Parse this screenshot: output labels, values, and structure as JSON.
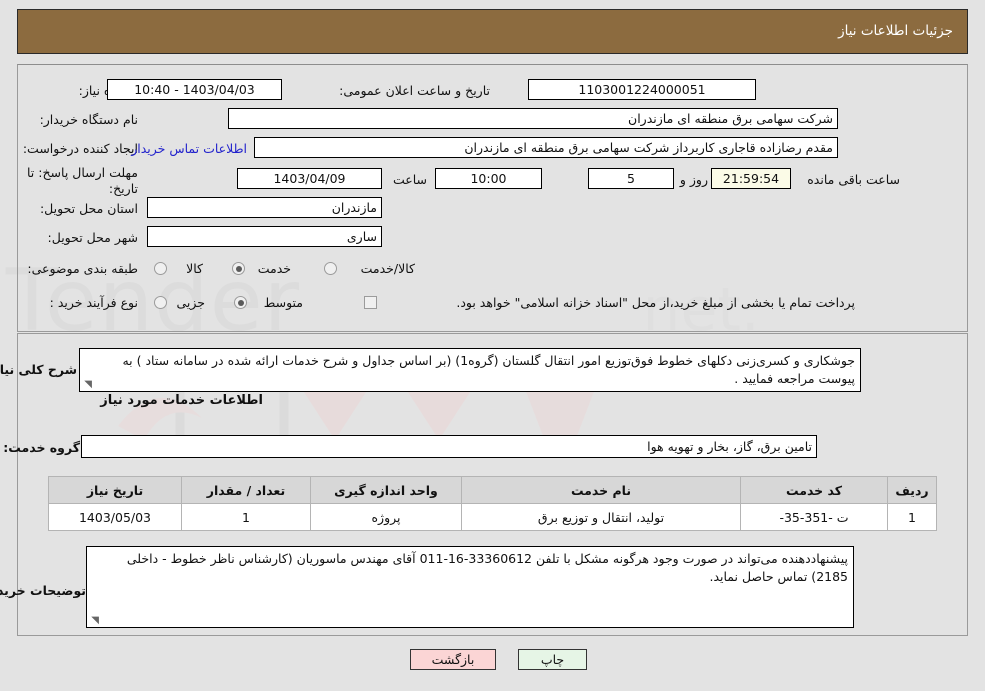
{
  "header": {
    "title": "جزئیات اطلاعات نیاز"
  },
  "form": {
    "need_number_label": "شماره نیاز:",
    "need_number_value": "1103001224000051",
    "announce_label": "تاریخ و ساعت اعلان عمومی:",
    "announce_value": "1403/04/03 - 10:40",
    "buyer_org_label": "نام دستگاه خریدار:",
    "buyer_org_value": "شرکت سهامی برق منطقه ای مازندران",
    "requester_label": "ایجاد کننده درخواست:",
    "requester_value": "مقدم رضازاده قاجاری کاربرداز شرکت سهامی برق منطقه ای مازندران",
    "contact_link": "اطلاعات تماس خریدار",
    "deadline_label": "مهلت ارسال پاسخ: تا تاریخ:",
    "deadline_date": "1403/04/09",
    "deadline_time_label": "ساعت",
    "deadline_time": "10:00",
    "days_value": "5",
    "days_unit": "روز و",
    "countdown_value": "21:59:54",
    "countdown_suffix": "ساعت باقی مانده",
    "province_label": "استان محل تحویل:",
    "province_value": "مازندران",
    "city_label": "شهر محل تحویل:",
    "city_value": "ساری",
    "category_label": "طبقه بندی موضوعی:",
    "category_options": [
      {
        "label": "کالا",
        "selected": false
      },
      {
        "label": "خدمت",
        "selected": true
      },
      {
        "label": "کالا/خدمت",
        "selected": false
      }
    ],
    "process_label": "نوع فرآیند خرید :",
    "process_options": [
      {
        "label": "جزیی",
        "selected": false
      },
      {
        "label": "متوسط",
        "selected": true
      }
    ],
    "treasury_checkbox_label": "پرداخت تمام یا بخشی از مبلغ خرید،از محل \"اسناد خزانه اسلامی\" خواهد بود.",
    "treasury_checked": false
  },
  "description": {
    "label": "شرح کلی نیاز:",
    "value": "جوشکاری و کسری‌زنی دکلهای خطوط فوق‌توزیع امور انتقال گلستان (گروه1) (بر اساس جداول و شرح خدمات ارائه شده در سامانه ستاد ) به پیوست مراجعه فمایید ."
  },
  "services": {
    "section_title": "اطلاعات خدمات مورد نیاز",
    "group_label": "گروه خدمت:",
    "group_value": "تامین برق، گاز، بخار و تهویه هوا",
    "table": {
      "columns": [
        "ردیف",
        "کد خدمت",
        "نام خدمت",
        "واحد اندازه گیری",
        "تعداد / مقدار",
        "تاریخ نیاز"
      ],
      "rows": [
        [
          "1",
          "ت -351-35-",
          "تولید، انتقال و توزیع برق",
          "پروژه",
          "1",
          "1403/05/03"
        ]
      ]
    }
  },
  "buyer_notes": {
    "label": "توضیحات خریدار:",
    "value": "پیشنهاددهنده می‌تواند در صورت وجود هرگونه مشکل با تلفن 33360612-16-011  آقای مهندس ماسوریان (کارشناس ناظر خطوط  - داخلی 2185) تماس حاصل نماید."
  },
  "footer": {
    "print_label": "چاپ",
    "back_label": "بازگشت"
  },
  "watermark": {
    "text": "AriaTender.net"
  }
}
